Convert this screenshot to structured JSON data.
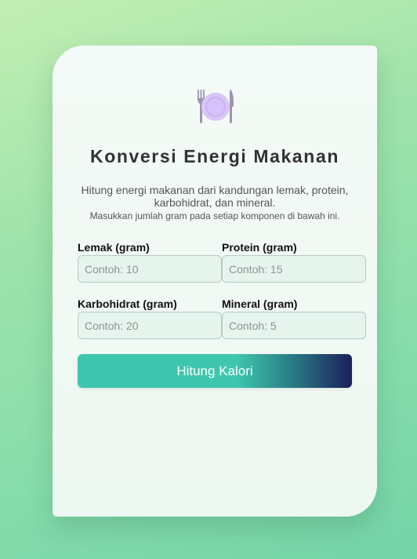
{
  "app": {
    "title": "Konversi Energi Makanan",
    "subtitle": "Hitung energi makanan dari kandungan lemak, protein, karbohidrat, dan mineral.",
    "hint": "Masukkan jumlah gram pada setiap komponen di bawah ini.",
    "logo_icon": "plate-cutlery-icon"
  },
  "form": {
    "fat": {
      "label": "Lemak (gram)",
      "placeholder": "Contoh: 10",
      "value": ""
    },
    "protein": {
      "label": "Protein (gram)",
      "placeholder": "Contoh: 15",
      "value": ""
    },
    "carbs": {
      "label": "Karbohidrat (gram)",
      "placeholder": "Contoh: 20",
      "value": ""
    },
    "mineral": {
      "label": "Mineral (gram)",
      "placeholder": "Contoh: 5",
      "value": ""
    },
    "submit_label": "Hitung Kalori"
  },
  "colors": {
    "accent": "#3fc6ae",
    "accent_dark": "#1c1f5c",
    "title": "#333333",
    "text": "#555555"
  }
}
